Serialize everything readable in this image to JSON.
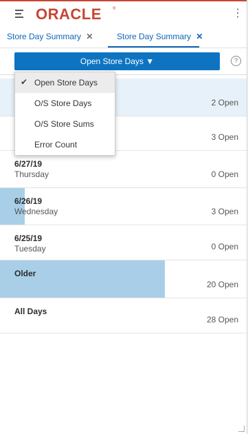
{
  "header": {
    "logo_text": "ORACLE",
    "logo_mark": "®",
    "menu_icon": "hamburger-icon",
    "more_icon": "kebab-icon",
    "kebab_glyph": "⋮",
    "brand_color": "#c74634"
  },
  "tabs": [
    {
      "label": "Store Day Summary",
      "close": "✕"
    },
    {
      "label": "Store Day Summary",
      "close": "✕"
    }
  ],
  "toolbar": {
    "dropdown_label": "Open Store Days ▼",
    "help_glyph": "?",
    "accent_color": "#0e74c2"
  },
  "menu": {
    "check_glyph": "✔",
    "items": [
      {
        "label": "Open Store Days",
        "selected": true
      },
      {
        "label": "O/S Store Days",
        "selected": false
      },
      {
        "label": "O/S Store Sums",
        "selected": false
      },
      {
        "label": "Error Count",
        "selected": false
      }
    ]
  },
  "list": [
    {
      "date": "",
      "day": "",
      "count": "2 Open",
      "open": 2
    },
    {
      "date": "",
      "day": "",
      "count": "3 Open",
      "open": 3
    },
    {
      "date": "6/27/19",
      "day": "Thursday",
      "count": "0 Open",
      "open": 0
    },
    {
      "date": "6/26/19",
      "day": "Wednesday",
      "count": "3 Open",
      "open": 3
    },
    {
      "date": "6/25/19",
      "day": "Tuesday",
      "count": "0 Open",
      "open": 0
    },
    {
      "date": "Older",
      "day": "",
      "count": "20 Open",
      "open": 20
    },
    {
      "date": "All Days",
      "day": "",
      "count": "28 Open",
      "open": 28
    }
  ],
  "bar_color": "#a9cfe8"
}
